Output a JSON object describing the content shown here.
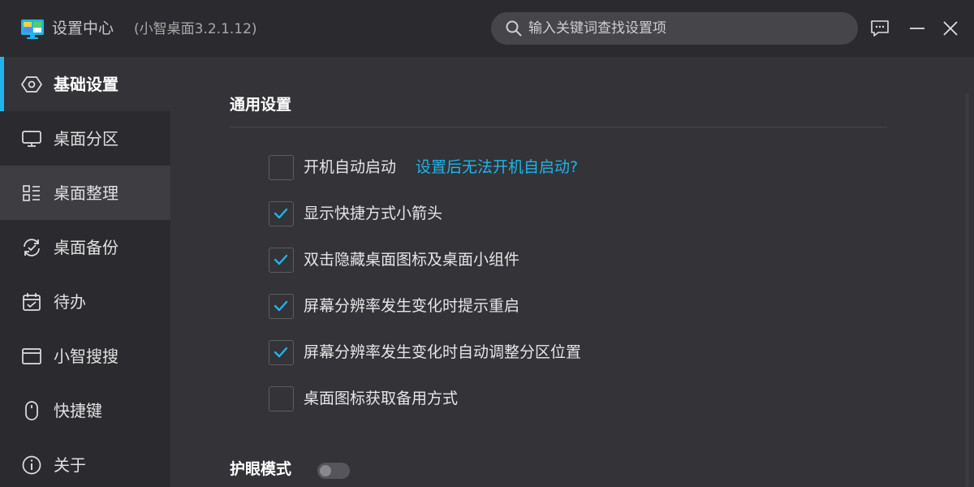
{
  "window": {
    "title": "设置中心",
    "version": "(小智桌面3.2.1.12)"
  },
  "search": {
    "placeholder": "输入关键词查找设置项",
    "value": ""
  },
  "sidebar": {
    "items": [
      {
        "label": "基础设置",
        "icon": "settings-hexagon-icon",
        "state": "active"
      },
      {
        "label": "桌面分区",
        "icon": "monitor-icon",
        "state": "normal"
      },
      {
        "label": "桌面整理",
        "icon": "grid-list-icon",
        "state": "hover"
      },
      {
        "label": "桌面备份",
        "icon": "sync-icon",
        "state": "normal"
      },
      {
        "label": "待办",
        "icon": "calendar-check-icon",
        "state": "normal"
      },
      {
        "label": "小智搜搜",
        "icon": "browser-window-icon",
        "state": "normal"
      },
      {
        "label": "快捷键",
        "icon": "mouse-icon",
        "state": "normal"
      },
      {
        "label": "关于",
        "icon": "info-icon",
        "state": "normal"
      }
    ]
  },
  "general": {
    "title": "通用设置",
    "options": [
      {
        "label": "开机自动启动",
        "checked": false,
        "link": "设置后无法开机自启动?"
      },
      {
        "label": "显示快捷方式小箭头",
        "checked": true
      },
      {
        "label": "双击隐藏桌面图标及桌面小组件",
        "checked": true
      },
      {
        "label": "屏幕分辨率发生变化时提示重启",
        "checked": true
      },
      {
        "label": "屏幕分辨率发生变化时自动调整分区位置",
        "checked": true
      },
      {
        "label": "桌面图标获取备用方式",
        "checked": false
      }
    ]
  },
  "eye_mode": {
    "title": "护眼模式",
    "enabled": false
  },
  "colors": {
    "accent": "#1fb5e8",
    "background": "#333338",
    "sidebar": "#2b2b2f"
  }
}
